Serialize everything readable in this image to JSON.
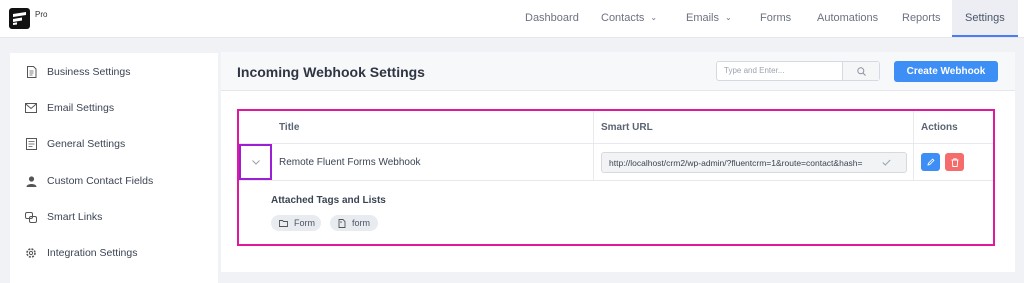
{
  "brand": {
    "badge": "Pro"
  },
  "nav": {
    "items": [
      {
        "label": "Dashboard",
        "dropdown": false
      },
      {
        "label": "Contacts",
        "dropdown": true
      },
      {
        "label": "Emails",
        "dropdown": true
      },
      {
        "label": "Forms",
        "dropdown": false
      },
      {
        "label": "Automations",
        "dropdown": false
      },
      {
        "label": "Reports",
        "dropdown": false
      },
      {
        "label": "Settings",
        "dropdown": false,
        "active": true
      }
    ]
  },
  "sidebar": {
    "items": [
      {
        "label": "Business Settings",
        "icon": "document-icon"
      },
      {
        "label": "Email Settings",
        "icon": "mail-icon"
      },
      {
        "label": "General Settings",
        "icon": "settings-list-icon"
      },
      {
        "label": "Custom Contact Fields",
        "icon": "user-icon"
      },
      {
        "label": "Smart Links",
        "icon": "links-icon"
      },
      {
        "label": "Integration Settings",
        "icon": "gear-icon"
      }
    ]
  },
  "main": {
    "title": "Incoming Webhook Settings",
    "search": {
      "placeholder": "Type and Enter..."
    },
    "create_button": "Create Webhook",
    "table": {
      "columns": [
        "Title",
        "Smart URL",
        "Actions"
      ],
      "rows": [
        {
          "title": "Remote Fluent Forms Webhook",
          "smart_url": "http://localhost/crm2/wp-admin/?fluentcrm=1&route=contact&hash=",
          "attached_heading": "Attached Tags and Lists",
          "tags": [
            "Form",
            "form"
          ]
        }
      ]
    }
  },
  "colors": {
    "accent": "#3d8ef5",
    "delete": "#f56c6c",
    "highlight_box": "#e0189c",
    "expand_box": "#9c1fd6"
  }
}
